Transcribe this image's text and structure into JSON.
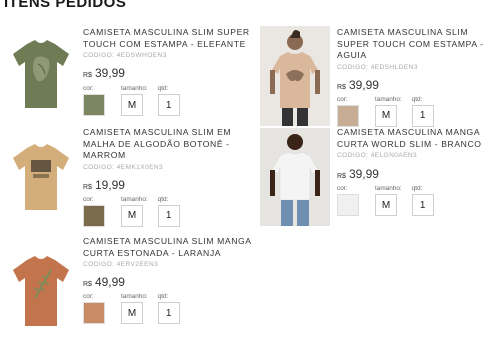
{
  "page": {
    "title": "ITENS PEDIDOS"
  },
  "labels": {
    "color": "cor:",
    "size": "tamanho:",
    "qty": "qtd:",
    "currency": "R$"
  },
  "items": [
    {
      "name": "CAMISETA MASCULINA SLIM SUPER TOUCH COM ESTAMPA - ELEFANTE",
      "code": "CODIGO: 4EDSWHOEN3",
      "price": "39,99",
      "size": "M",
      "qty": "1",
      "shirt_color": "#6f7b55",
      "swatch_color": "#7c8660"
    },
    {
      "name": "CAMISETA MASCULINA SLIM EM MALHA DE ALGODÃO BOTONÊ - MARROM",
      "code": "CODIGO: 4EMK1X0EN3",
      "price": "19,99",
      "size": "M",
      "qty": "1",
      "shirt_color": "#d3ad7a",
      "swatch_color": "#7a6b4c"
    },
    {
      "name": "CAMISETA MASCULINA SLIM MANGA CURTA ESTONADA - LARANJA",
      "code": "CODIGO: 4ERV2EEN3",
      "price": "49,99",
      "size": "M",
      "qty": "1",
      "shirt_color": "#c4744d",
      "swatch_color": "#c98a66"
    },
    {
      "name": "CAMISETA MASCULINA SLIM SUPER TOUCH COM ESTAMPA - AGUIA",
      "code": "CODIGO: 4EDSHLDEN3",
      "price": "39,99",
      "size": "M",
      "qty": "1",
      "shirt_color": "#d9b89c",
      "swatch_color": "#c8ad95"
    },
    {
      "name": "CAMISETA MASCULINA MANGA CURTA WORLD SLIM - BRANCO",
      "code": "CODIGO: 4ELGN0AEN3",
      "price": "39,99",
      "size": "M",
      "qty": "1",
      "shirt_color": "#f4f4f4",
      "swatch_color": "#f0f0f0"
    }
  ]
}
